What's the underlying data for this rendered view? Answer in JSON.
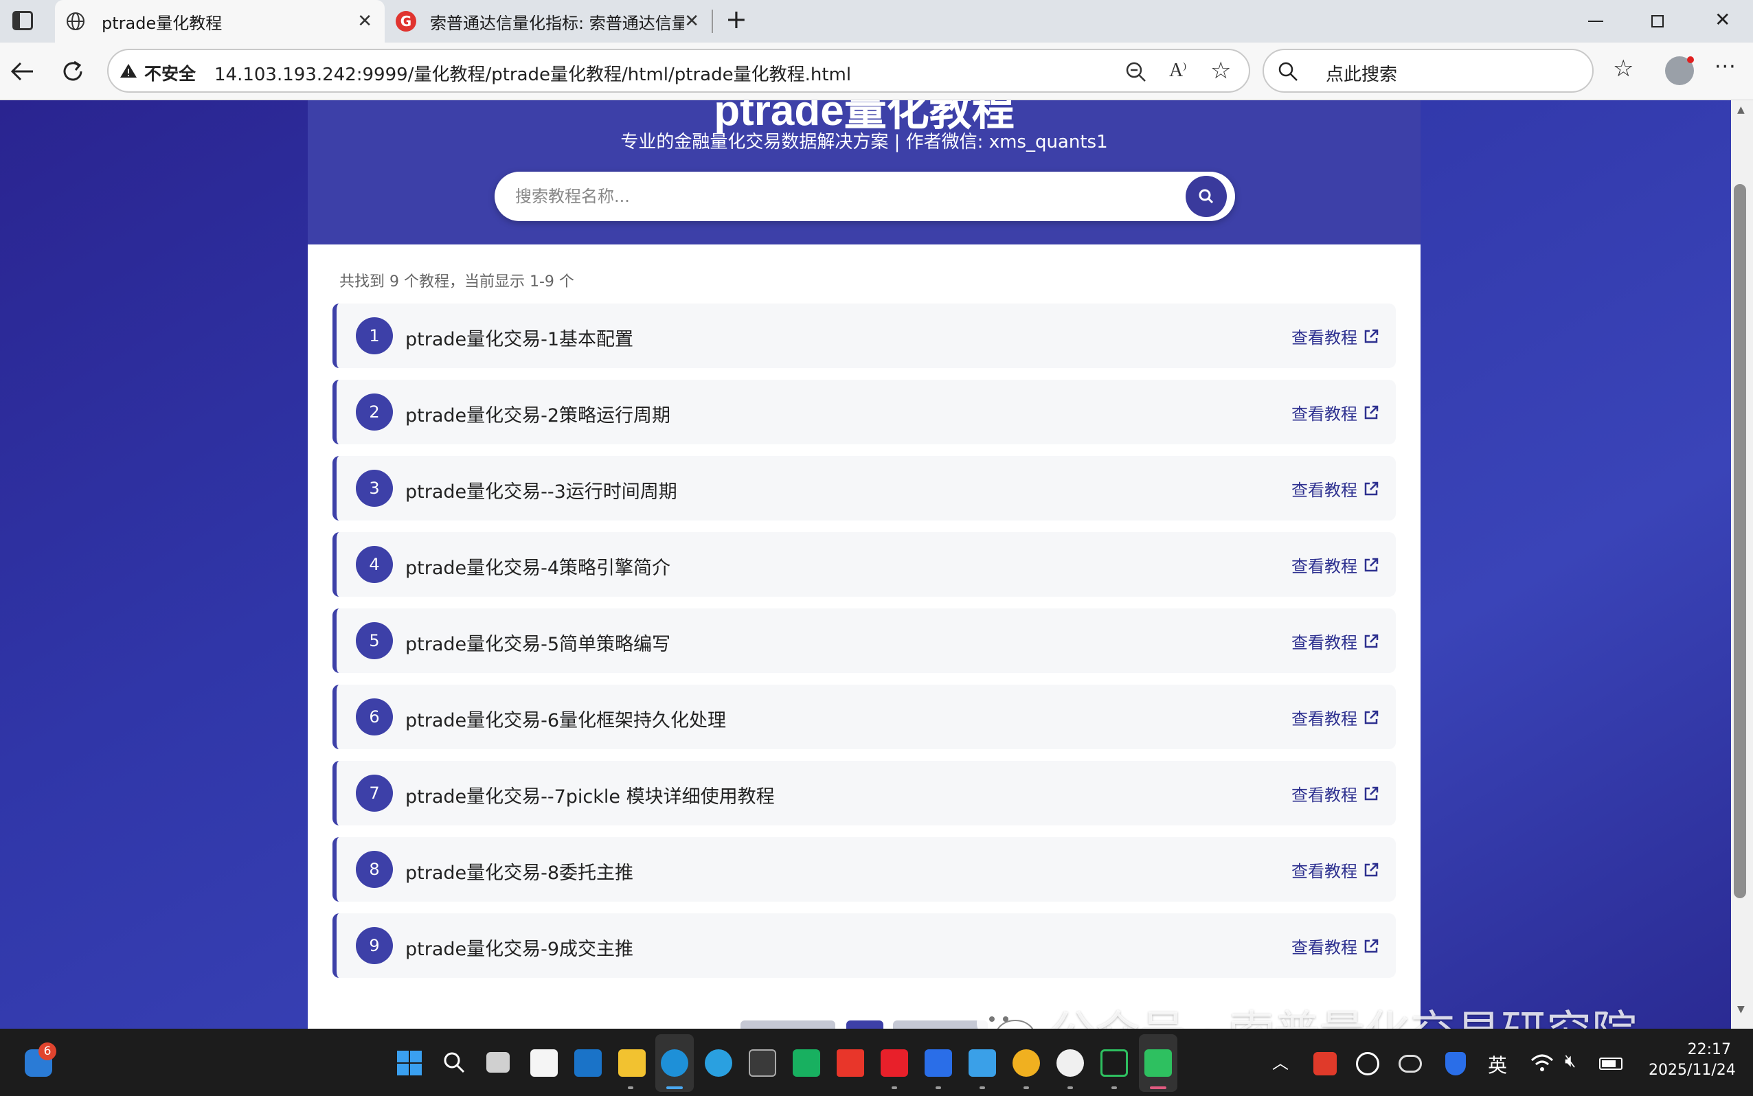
{
  "browser": {
    "tabs": [
      {
        "title": "ptrade量化教程",
        "active": true
      },
      {
        "title": "索普通达信量化指标: 索普通达信量",
        "active": false
      }
    ],
    "security_label": "不安全",
    "url": "14.103.193.242:9999/量化教程/ptrade量化教程/html/ptrade量化教程.html",
    "search_placeholder": "点此搜索"
  },
  "page": {
    "title": "ptrade量化教程",
    "subtitle": "专业的金融量化交易数据解决方案 | 作者微信: xms_quants1",
    "search_placeholder": "搜索教程名称...",
    "count_text": "共找到 9 个教程，当前显示 1-9 个",
    "link_label": "查看教程",
    "tutorials": [
      {
        "num": "1",
        "title": "ptrade量化交易-1基本配置"
      },
      {
        "num": "2",
        "title": "ptrade量化交易-2策略运行周期"
      },
      {
        "num": "3",
        "title": "ptrade量化交易--3运行时间周期"
      },
      {
        "num": "4",
        "title": "ptrade量化交易-4策略引擎简介"
      },
      {
        "num": "5",
        "title": "ptrade量化交易-5简单策略编写"
      },
      {
        "num": "6",
        "title": "ptrade量化交易-6量化框架持久化处理"
      },
      {
        "num": "7",
        "title": "ptrade量化交易--7pickle 模块详细使用教程"
      },
      {
        "num": "8",
        "title": "ptrade量化交易-8委托主推"
      },
      {
        "num": "9",
        "title": "ptrade量化交易-9成交主推"
      }
    ]
  },
  "watermark": "公众号 · 索普量化交易研究院",
  "taskbar": {
    "notification_badge": "6",
    "ime_label": "英",
    "time": "22:17",
    "date": "2025/11/24"
  },
  "colors": {
    "accent": "#3d40a8",
    "page_bg": "#2e2f9e",
    "link": "#2e3190"
  }
}
